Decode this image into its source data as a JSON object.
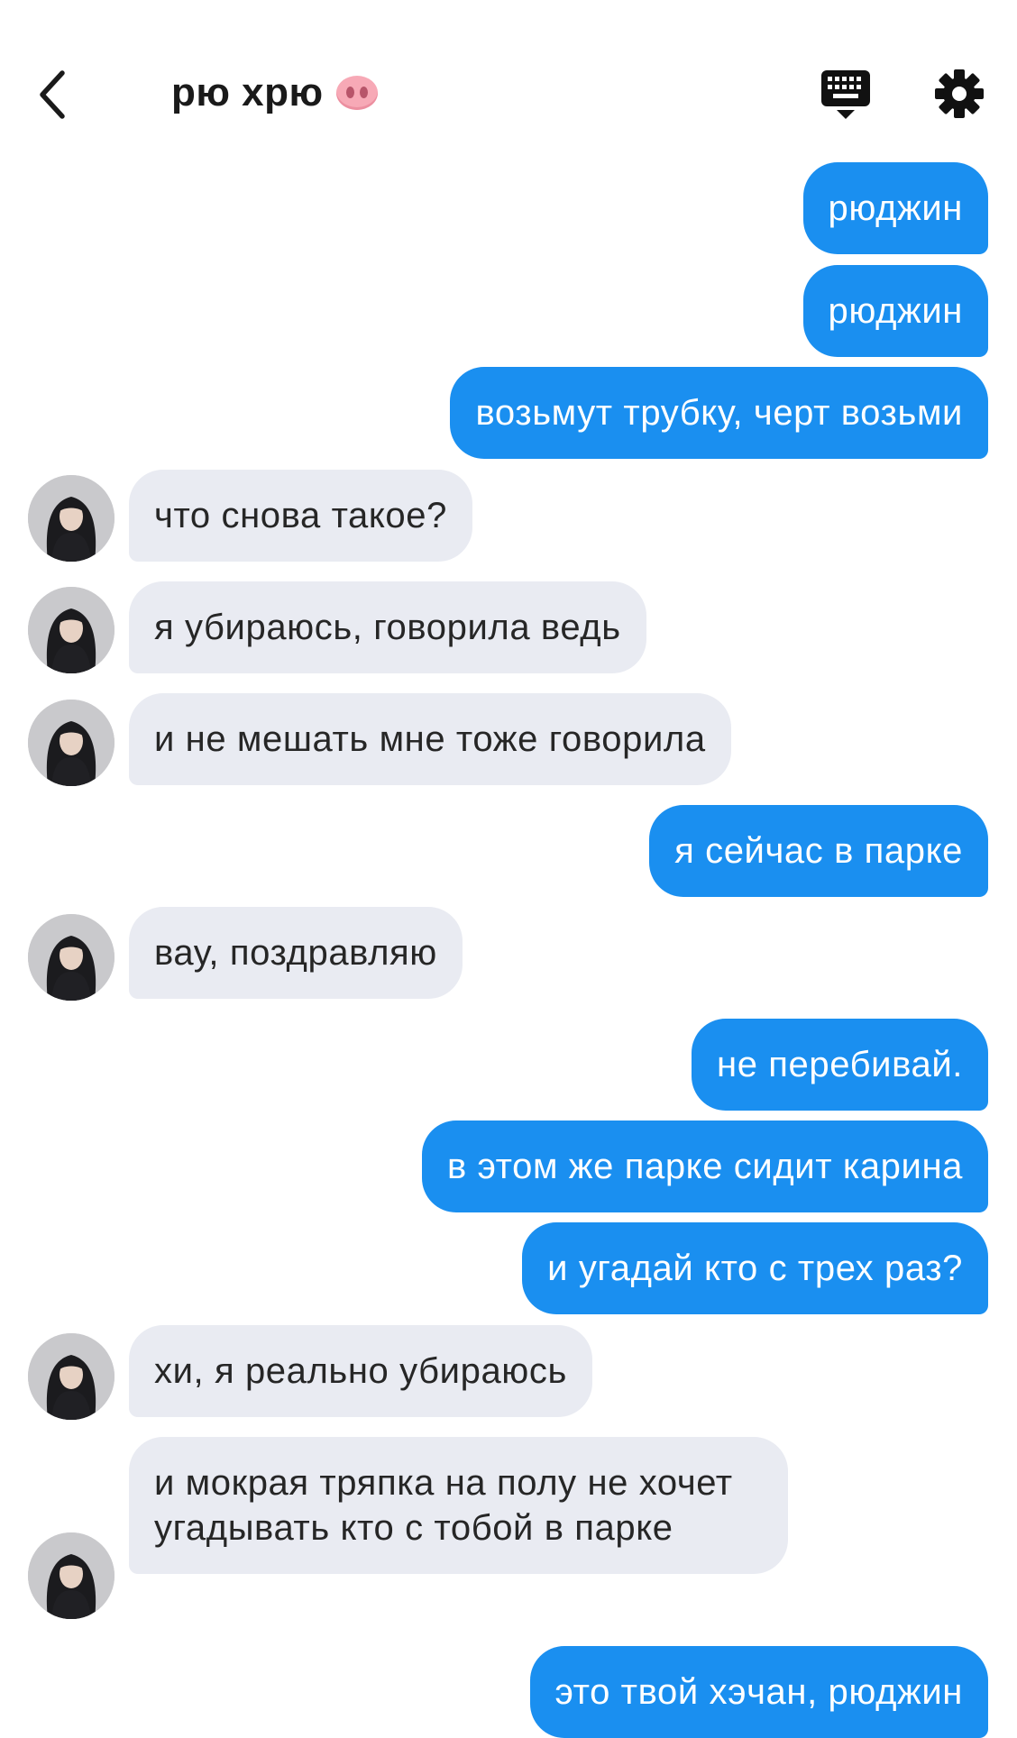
{
  "header": {
    "title": "рю хрю",
    "back_icon": "chevron-left-icon",
    "keyboard_icon": "keyboard-icon",
    "settings_icon": "gear-icon",
    "title_emoji": "pig-nose-icon"
  },
  "colors": {
    "outgoing_bubble": "#1a8ff0",
    "incoming_bubble": "#e9ebf2",
    "outgoing_text": "#ffffff",
    "incoming_text": "#262626"
  },
  "messages": [
    {
      "side": "out",
      "text": "рюджин"
    },
    {
      "side": "out",
      "text": "рюджин"
    },
    {
      "side": "out",
      "text": "возьмут трубку, черт возьми"
    },
    {
      "side": "in",
      "text": "что снова такое?"
    },
    {
      "side": "in",
      "text": "я убираюсь, говорила ведь"
    },
    {
      "side": "in",
      "text": "и не мешать мне тоже говорила"
    },
    {
      "side": "out",
      "text": "я сейчас в парке"
    },
    {
      "side": "in",
      "text": "вау, поздравляю"
    },
    {
      "side": "out",
      "text": "не перебивай."
    },
    {
      "side": "out",
      "text": "в этом же парке сидит карина"
    },
    {
      "side": "out",
      "text": "и угадай кто с трех раз?"
    },
    {
      "side": "in",
      "text": "хи, я реально убираюсь"
    },
    {
      "side": "in",
      "text": "и мокрая тряпка на полу не хочет угадывать кто с тобой в парке"
    },
    {
      "side": "out",
      "text": "это твой хэчан, рюджин"
    }
  ]
}
